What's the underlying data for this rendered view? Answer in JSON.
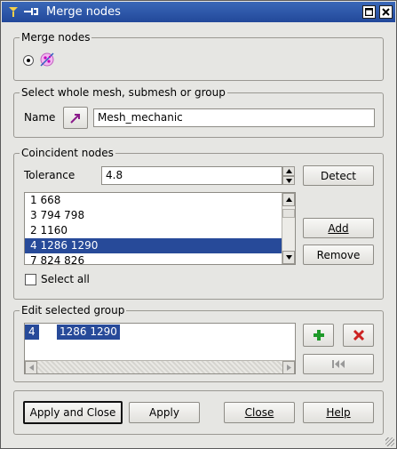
{
  "window": {
    "title": "Merge nodes"
  },
  "merge_nodes": {
    "legend": "Merge nodes",
    "algorithm_icon": "merge-nodes-icon"
  },
  "select": {
    "legend": "Select whole mesh, submesh or group",
    "name_label": "Name",
    "name_value": "Mesh_mechanic"
  },
  "coincident": {
    "legend": "Coincident nodes",
    "tolerance_label": "Tolerance",
    "tolerance_value": "4.8",
    "detect_label": "Detect",
    "add_label": "Add",
    "remove_label": "Remove",
    "select_all_label": "Select all",
    "items": [
      "1 668",
      "3 794 798",
      "2 1160",
      "4 1286 1290",
      "7 824 826"
    ],
    "selected_index": 3
  },
  "edit_group": {
    "legend": "Edit selected group",
    "row_id": "4",
    "row_nodes": "1286 1290"
  },
  "buttons": {
    "apply_close": "Apply and Close",
    "apply": "Apply",
    "close": "Close",
    "help": "Help"
  },
  "colors": {
    "selection": "#274a99",
    "titlebar": "#22489a",
    "add_green": "#1f9a2a",
    "remove_red": "#cc2222"
  }
}
